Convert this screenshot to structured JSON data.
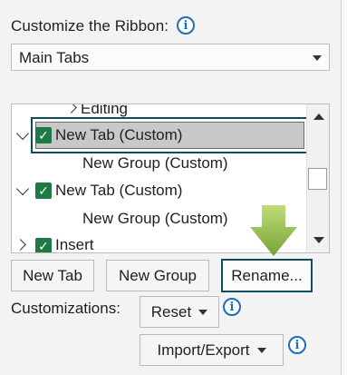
{
  "header": {
    "title": "Customize the Ribbon:",
    "info_icon": "info-icon"
  },
  "tab_select": {
    "value": "Main Tabs"
  },
  "tree": {
    "items": [
      {
        "label": "Editing",
        "expander": "chevron-right",
        "checked": false
      },
      {
        "label": "New Tab (Custom)",
        "expander": "chevron-down",
        "checked": true,
        "selected": true
      },
      {
        "label": "New Group (Custom)"
      },
      {
        "label": "New Tab (Custom)",
        "expander": "chevron-down",
        "checked": true
      },
      {
        "label": "New Group (Custom)"
      },
      {
        "label": "Insert",
        "expander": "chevron-right",
        "checked": true
      }
    ]
  },
  "buttons": {
    "new_tab": "New Tab",
    "new_group": "New Group",
    "rename": "Rename..."
  },
  "customizations": {
    "label": "Customizations:",
    "reset": "Reset",
    "import_export": "Import/Export"
  },
  "colors": {
    "check_green": "#1e7a45",
    "focus_border": "#0f4c5c",
    "info_blue": "#1d6fb8",
    "hint_arrow": "#8db83a"
  }
}
